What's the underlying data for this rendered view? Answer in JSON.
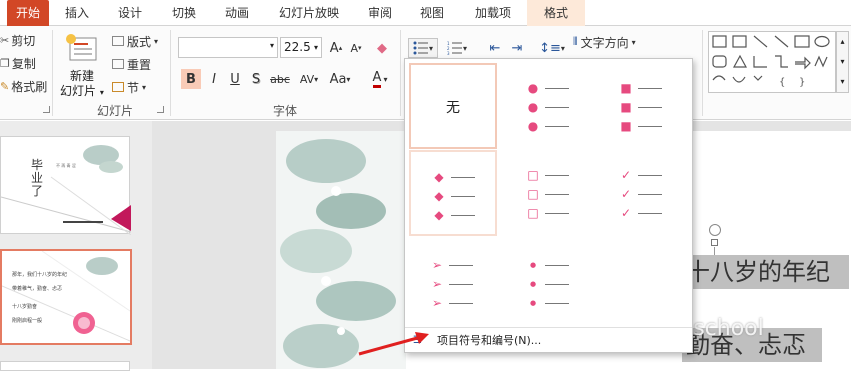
{
  "tabs": [
    "开始",
    "插入",
    "设计",
    "切换",
    "动画",
    "幻灯片放映",
    "审阅",
    "视图",
    "加载项",
    "格式"
  ],
  "clipboard": {
    "cut": "剪切",
    "copy": "复制",
    "format_painter": "格式刷"
  },
  "slides_group": {
    "new_slide_line1": "新建",
    "new_slide_line2": "幻灯片",
    "layout": "版式",
    "reset": "重置",
    "section": "节",
    "label": "幻灯片"
  },
  "font_group": {
    "font_name": "",
    "font_size": "22.5",
    "label": "字体",
    "bold": "B",
    "italic": "I",
    "underline": "U",
    "shadow": "S",
    "strike": "abc",
    "spacing": "AV",
    "case": "Aa",
    "color": "A",
    "grow": "A",
    "shrink": "A"
  },
  "paragraph": {
    "text_direction": "文字方向"
  },
  "bullet_menu": {
    "none_label": "无",
    "footer_label": "项目符号和编号(N)...",
    "styles": [
      "none",
      "filled-round",
      "filled-square",
      "diamond",
      "hollow-square",
      "checkmark",
      "arrowhead",
      "small-dot"
    ]
  },
  "slide_thumbs": {
    "slide1_title": "毕 业 了",
    "slide1_sub": "不 再 青 涩",
    "slide2_lines": [
      "那年，我们十八岁的年纪",
      "带着稚气，勤奋、忐忑",
      "十八岁勤奋",
      "刚刚启程一般"
    ]
  },
  "canvas_text": {
    "line1": "十八岁的年纪",
    "line2": "勤奋、忐忑"
  },
  "watermark": "微信号: officeschool",
  "colors": {
    "accent": "#d24726",
    "bullet": "#e64a7f",
    "selection": "#f3c9b7"
  }
}
